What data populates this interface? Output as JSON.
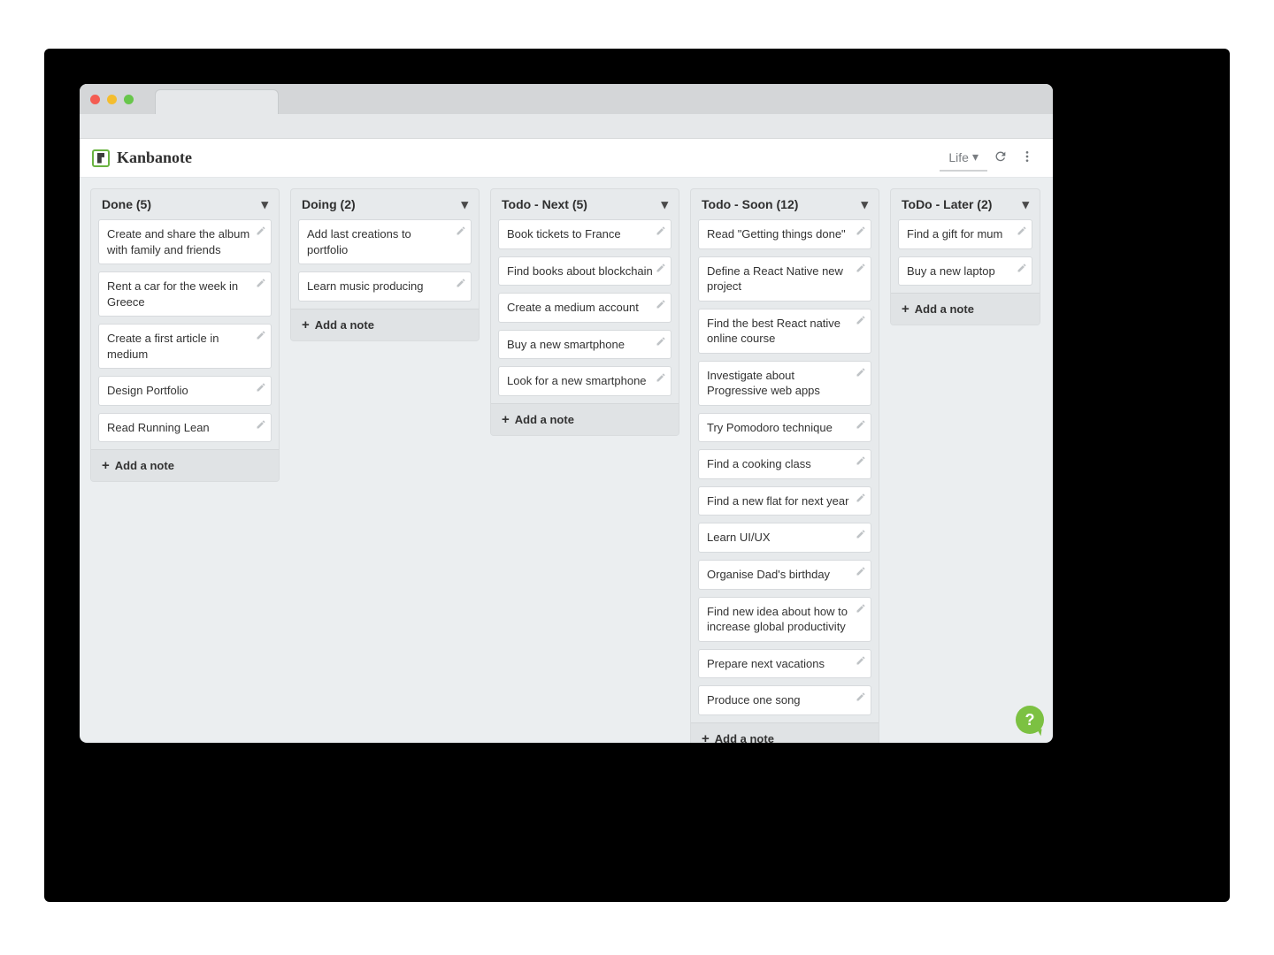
{
  "app": {
    "name": "Kanbanote",
    "board_selector_label": "Life",
    "add_note_label": "Add a note"
  },
  "columns": [
    {
      "title": "Done (5)",
      "cards": [
        "Create and share the album with family and friends",
        "Rent a car for the week in Greece",
        "Create a first article in medium",
        "Design Portfolio",
        "Read Running Lean"
      ]
    },
    {
      "title": "Doing (2)",
      "cards": [
        "Add last creations to portfolio",
        "Learn music producing"
      ]
    },
    {
      "title": "Todo - Next (5)",
      "cards": [
        "Book tickets to France",
        "Find books about blockchain",
        "Create a medium account",
        "Buy a new smartphone",
        "Look for a new smartphone"
      ]
    },
    {
      "title": "Todo - Soon (12)",
      "cards": [
        "Read \"Getting things done\"",
        "Define a React Native new project",
        "Find the best React native online course",
        "Investigate about Progressive web apps",
        "Try Pomodoro technique",
        "Find a cooking class",
        "Find a new flat for next year",
        "Learn UI/UX",
        "Organise Dad's birthday",
        "Find new idea about how to increase global productivity",
        "Prepare next vacations",
        "Produce one song"
      ]
    },
    {
      "title": "ToDo - Later (2)",
      "cards": [
        "Find a gift for mum",
        "Buy a new laptop"
      ]
    }
  ]
}
